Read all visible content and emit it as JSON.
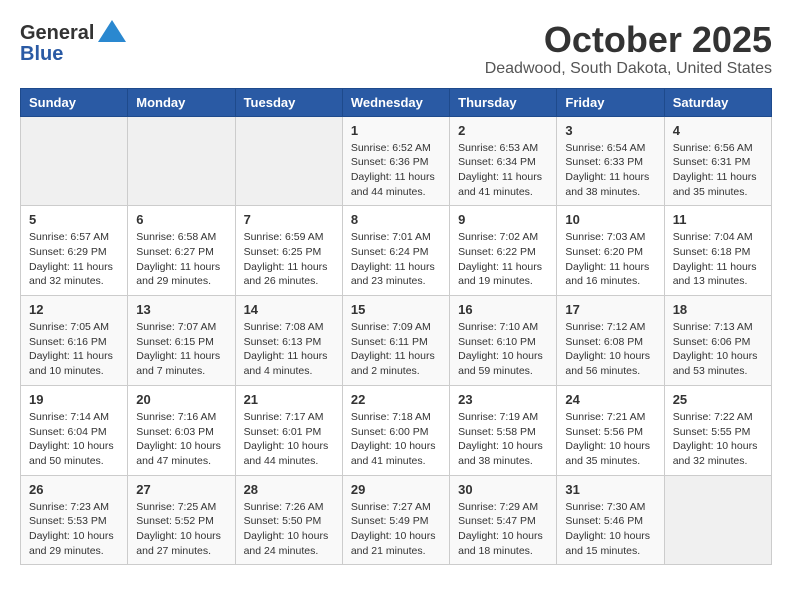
{
  "header": {
    "logo_general": "General",
    "logo_blue": "Blue",
    "month": "October 2025",
    "location": "Deadwood, South Dakota, United States"
  },
  "weekdays": [
    "Sunday",
    "Monday",
    "Tuesday",
    "Wednesday",
    "Thursday",
    "Friday",
    "Saturday"
  ],
  "weeks": [
    [
      {
        "day": "",
        "info": ""
      },
      {
        "day": "",
        "info": ""
      },
      {
        "day": "",
        "info": ""
      },
      {
        "day": "1",
        "info": "Sunrise: 6:52 AM\nSunset: 6:36 PM\nDaylight: 11 hours\nand 44 minutes."
      },
      {
        "day": "2",
        "info": "Sunrise: 6:53 AM\nSunset: 6:34 PM\nDaylight: 11 hours\nand 41 minutes."
      },
      {
        "day": "3",
        "info": "Sunrise: 6:54 AM\nSunset: 6:33 PM\nDaylight: 11 hours\nand 38 minutes."
      },
      {
        "day": "4",
        "info": "Sunrise: 6:56 AM\nSunset: 6:31 PM\nDaylight: 11 hours\nand 35 minutes."
      }
    ],
    [
      {
        "day": "5",
        "info": "Sunrise: 6:57 AM\nSunset: 6:29 PM\nDaylight: 11 hours\nand 32 minutes."
      },
      {
        "day": "6",
        "info": "Sunrise: 6:58 AM\nSunset: 6:27 PM\nDaylight: 11 hours\nand 29 minutes."
      },
      {
        "day": "7",
        "info": "Sunrise: 6:59 AM\nSunset: 6:25 PM\nDaylight: 11 hours\nand 26 minutes."
      },
      {
        "day": "8",
        "info": "Sunrise: 7:01 AM\nSunset: 6:24 PM\nDaylight: 11 hours\nand 23 minutes."
      },
      {
        "day": "9",
        "info": "Sunrise: 7:02 AM\nSunset: 6:22 PM\nDaylight: 11 hours\nand 19 minutes."
      },
      {
        "day": "10",
        "info": "Sunrise: 7:03 AM\nSunset: 6:20 PM\nDaylight: 11 hours\nand 16 minutes."
      },
      {
        "day": "11",
        "info": "Sunrise: 7:04 AM\nSunset: 6:18 PM\nDaylight: 11 hours\nand 13 minutes."
      }
    ],
    [
      {
        "day": "12",
        "info": "Sunrise: 7:05 AM\nSunset: 6:16 PM\nDaylight: 11 hours\nand 10 minutes."
      },
      {
        "day": "13",
        "info": "Sunrise: 7:07 AM\nSunset: 6:15 PM\nDaylight: 11 hours\nand 7 minutes."
      },
      {
        "day": "14",
        "info": "Sunrise: 7:08 AM\nSunset: 6:13 PM\nDaylight: 11 hours\nand 4 minutes."
      },
      {
        "day": "15",
        "info": "Sunrise: 7:09 AM\nSunset: 6:11 PM\nDaylight: 11 hours\nand 2 minutes."
      },
      {
        "day": "16",
        "info": "Sunrise: 7:10 AM\nSunset: 6:10 PM\nDaylight: 10 hours\nand 59 minutes."
      },
      {
        "day": "17",
        "info": "Sunrise: 7:12 AM\nSunset: 6:08 PM\nDaylight: 10 hours\nand 56 minutes."
      },
      {
        "day": "18",
        "info": "Sunrise: 7:13 AM\nSunset: 6:06 PM\nDaylight: 10 hours\nand 53 minutes."
      }
    ],
    [
      {
        "day": "19",
        "info": "Sunrise: 7:14 AM\nSunset: 6:04 PM\nDaylight: 10 hours\nand 50 minutes."
      },
      {
        "day": "20",
        "info": "Sunrise: 7:16 AM\nSunset: 6:03 PM\nDaylight: 10 hours\nand 47 minutes."
      },
      {
        "day": "21",
        "info": "Sunrise: 7:17 AM\nSunset: 6:01 PM\nDaylight: 10 hours\nand 44 minutes."
      },
      {
        "day": "22",
        "info": "Sunrise: 7:18 AM\nSunset: 6:00 PM\nDaylight: 10 hours\nand 41 minutes."
      },
      {
        "day": "23",
        "info": "Sunrise: 7:19 AM\nSunset: 5:58 PM\nDaylight: 10 hours\nand 38 minutes."
      },
      {
        "day": "24",
        "info": "Sunrise: 7:21 AM\nSunset: 5:56 PM\nDaylight: 10 hours\nand 35 minutes."
      },
      {
        "day": "25",
        "info": "Sunrise: 7:22 AM\nSunset: 5:55 PM\nDaylight: 10 hours\nand 32 minutes."
      }
    ],
    [
      {
        "day": "26",
        "info": "Sunrise: 7:23 AM\nSunset: 5:53 PM\nDaylight: 10 hours\nand 29 minutes."
      },
      {
        "day": "27",
        "info": "Sunrise: 7:25 AM\nSunset: 5:52 PM\nDaylight: 10 hours\nand 27 minutes."
      },
      {
        "day": "28",
        "info": "Sunrise: 7:26 AM\nSunset: 5:50 PM\nDaylight: 10 hours\nand 24 minutes."
      },
      {
        "day": "29",
        "info": "Sunrise: 7:27 AM\nSunset: 5:49 PM\nDaylight: 10 hours\nand 21 minutes."
      },
      {
        "day": "30",
        "info": "Sunrise: 7:29 AM\nSunset: 5:47 PM\nDaylight: 10 hours\nand 18 minutes."
      },
      {
        "day": "31",
        "info": "Sunrise: 7:30 AM\nSunset: 5:46 PM\nDaylight: 10 hours\nand 15 minutes."
      },
      {
        "day": "",
        "info": ""
      }
    ]
  ]
}
